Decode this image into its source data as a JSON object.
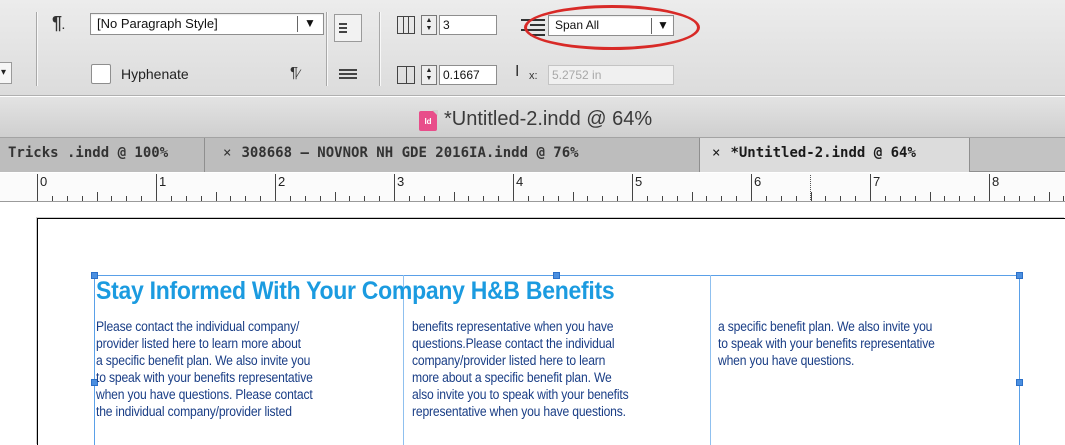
{
  "control_panel": {
    "paragraph_style": "[No Paragraph Style]",
    "hyphenate_label": "Hyphenate",
    "hyphenate_checked": false,
    "columns_value": "3",
    "gutter_value": "0.1667",
    "span_columns_value": "Span All",
    "vertical_justification_value": "5.2752 in",
    "vertical_justification_symbol": "x:",
    "icons": [
      "pilcrow-icon",
      "align-left-icon",
      "align-right-icon",
      "column-grid-icon",
      "gutter-icon",
      "span-columns-icon",
      "vertical-justification-icon"
    ],
    "highlight_color": "#d82a27"
  },
  "window": {
    "title": "*Untitled-2.indd @ 64%",
    "doc_icon_text": "Id",
    "doc_icon_color": "#e84d8a"
  },
  "tabs": [
    {
      "label": "Tricks .indd @ 100%",
      "has_close": false,
      "active": false
    },
    {
      "label": "308668 – NOVNOR NH GDE 2016IA.indd @ 76%",
      "has_close": true,
      "active": false
    },
    {
      "label": "*Untitled-2.indd @ 64%",
      "has_close": true,
      "active": true
    }
  ],
  "tab_close_glyph": "×",
  "ruler": {
    "numbers": [
      "0",
      "1",
      "2",
      "3",
      "4",
      "5",
      "6",
      "7",
      "8"
    ]
  },
  "document": {
    "headline": "Stay Informed With Your Company H&B Benefits",
    "headline_color": "#1b9be0",
    "body_color": "#1a3e86",
    "frame_color": "#5aa0e8",
    "columns": [
      [
        "Please contact the individual company/",
        "provider listed here to learn more about",
        "a specific benefit plan. We also invite you",
        "to speak with your benefits representative",
        "when you have questions. Please contact",
        "the individual company/provider listed"
      ],
      [
        "benefits representative when you have",
        "questions.Please contact the individual",
        "company/provider listed here to learn",
        "more about a specific benefit plan. We",
        "also invite you to speak with your benefits",
        "representative when you have questions."
      ],
      [
        "a specific benefit plan. We also invite you",
        "to speak with your benefits representative",
        "when you have questions."
      ]
    ]
  }
}
